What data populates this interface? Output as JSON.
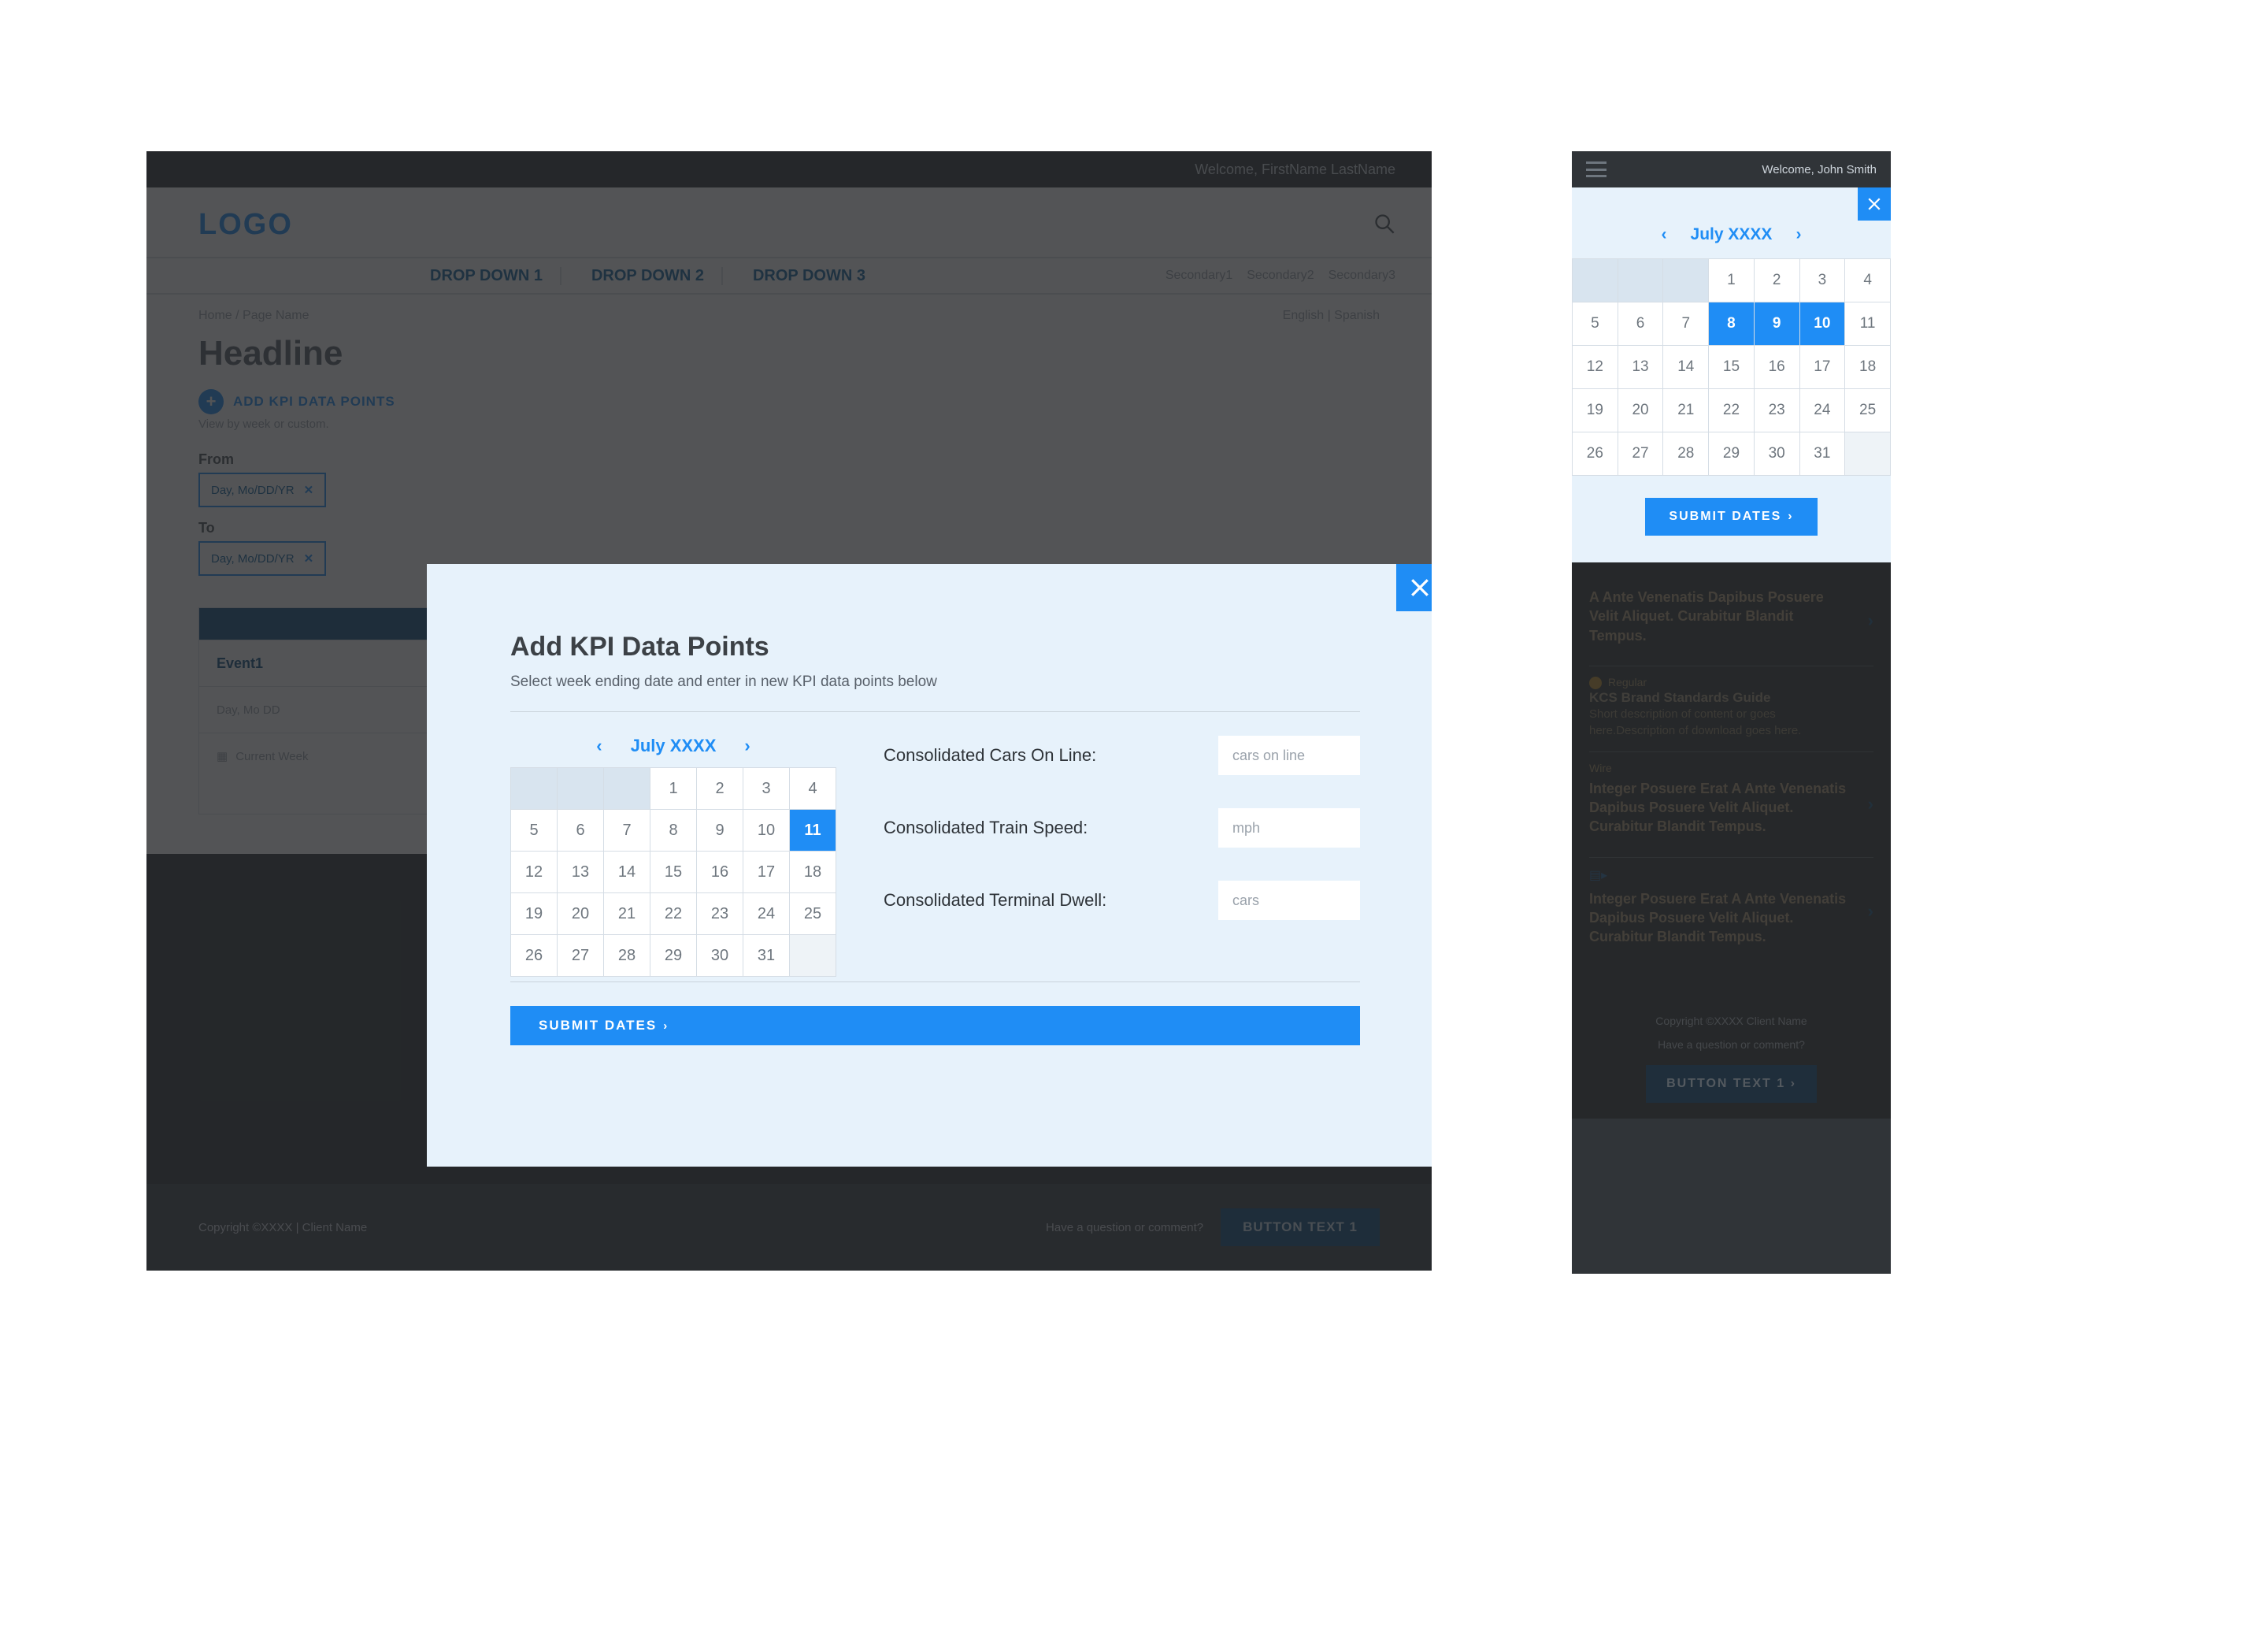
{
  "desktop": {
    "topbar_welcome": "Welcome, FirstName LastName",
    "logo": "LOGO",
    "nav_primary": [
      "DROP DOWN 1",
      "DROP DOWN 2",
      "DROP DOWN 3"
    ],
    "nav_secondary": [
      "Secondary1",
      "Secondary2",
      "Secondary3"
    ],
    "breadcrumb": "Home / Page Name",
    "languages": "English | Spanish",
    "headline": "Headline",
    "add_label": "ADD KPI DATA POINTS",
    "view_hint": "View by week or custom.",
    "from_label": "From",
    "to_label": "To",
    "pill_text": "Day, Mo/DD/YR",
    "table_event_header": "Event1",
    "table_row1": "Day, Mo DD",
    "table_row2": "Current Week",
    "footer_copyright": "Copyright ©XXXX | Client Name",
    "footer_question": "Have a question or comment?",
    "footer_button": "BUTTON TEXT 1"
  },
  "modal": {
    "title": "Add KPI Data Points",
    "subtitle": "Select week ending date and enter in new KPI data points below",
    "month_label": "July XXXX",
    "selected_day": 11,
    "days": [
      [
        null,
        null,
        null,
        1,
        2,
        3,
        4
      ],
      [
        5,
        6,
        7,
        8,
        9,
        10,
        11
      ],
      [
        12,
        13,
        14,
        15,
        16,
        17,
        18
      ],
      [
        19,
        20,
        21,
        22,
        23,
        24,
        25
      ],
      [
        26,
        27,
        28,
        29,
        30,
        31,
        null
      ]
    ],
    "fields": [
      {
        "label": "Consolidated Cars On Line:",
        "placeholder": "cars on line"
      },
      {
        "label": "Consolidated Train Speed:",
        "placeholder": "mph"
      },
      {
        "label": "Consolidated Terminal Dwell:",
        "placeholder": "cars"
      }
    ],
    "submit_label": "SUBMIT DATES"
  },
  "mobile": {
    "topbar_welcome": "Welcome, John Smith",
    "month_label": "July XXXX",
    "selected_days": [
      8,
      9,
      10
    ],
    "days": [
      [
        null,
        null,
        null,
        1,
        2,
        3,
        4
      ],
      [
        5,
        6,
        7,
        8,
        9,
        10,
        11
      ],
      [
        12,
        13,
        14,
        15,
        16,
        17,
        18
      ],
      [
        19,
        20,
        21,
        22,
        23,
        24,
        25
      ],
      [
        26,
        27,
        28,
        29,
        30,
        31,
        null
      ]
    ],
    "submit_label": "SUBMIT DATES",
    "cards": [
      {
        "title": "A Ante Venenatis Dapibus Posuere Velit Aliquet. Curabitur Blandit Tempus."
      },
      {
        "tag": "Regular",
        "subtitle": "KCS Brand Standards Guide",
        "text": "Short description of content or goes here.Description of download goes here."
      },
      {
        "tag": "Wire",
        "title": "Integer Posuere Erat A Ante Venenatis Dapibus Posuere Velit Aliquet. Curabitur Blandit Tempus."
      },
      {
        "title": "Integer Posuere Erat A Ante Venenatis Dapibus Posuere Velit Aliquet. Curabitur Blandit Tempus."
      }
    ],
    "footer_copyright": "Copyright ©XXXX Client Name",
    "footer_question": "Have a question or comment?",
    "footer_button": "BUTTON TEXT 1"
  }
}
